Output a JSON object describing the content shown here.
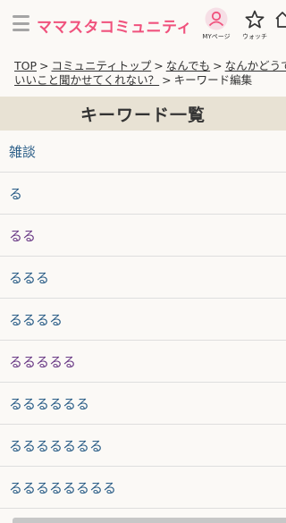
{
  "header": {
    "logo": "ママスタコミュニティ",
    "nav": [
      {
        "label": "MYページ",
        "icon": "user-icon"
      },
      {
        "label": "ウォッチ",
        "icon": "star-icon"
      }
    ]
  },
  "breadcrumb": {
    "items": [
      "TOP",
      "コミュニティトップ",
      "なんでも",
      "なんかどうでもいいこと聞かせてくれない？"
    ],
    "current": "キーワード編集",
    "separator": ">",
    "line1": [
      {
        "text": "TOP"
      },
      {
        "text": "コミュニティトップ"
      },
      {
        "text": "なんでも"
      },
      {
        "text": "なんかどうでも"
      }
    ],
    "line2_link": "いいこと聞かせてくれない？"
  },
  "page_title": "キーワード一覧",
  "keywords": [
    {
      "label": "雑談",
      "color": "#2a5d87"
    },
    {
      "label": "る",
      "color": "#2a5d87"
    },
    {
      "label": "るる",
      "color": "#6a3a86"
    },
    {
      "label": "るるる",
      "color": "#2a5d87"
    },
    {
      "label": "るるるる",
      "color": "#2a5d87"
    },
    {
      "label": "るるるるる",
      "color": "#6a3a86"
    },
    {
      "label": "るるるるるる",
      "color": "#2a5d87"
    },
    {
      "label": "るるるるるるる",
      "color": "#2a5d87"
    },
    {
      "label": "るるるるるるるる",
      "color": "#2a5d87"
    }
  ],
  "colors": {
    "brand": "#f0527d",
    "link_unvisited": "#2a5d87",
    "link_visited": "#6a3a86",
    "title_bar": "#e8e2d4"
  }
}
